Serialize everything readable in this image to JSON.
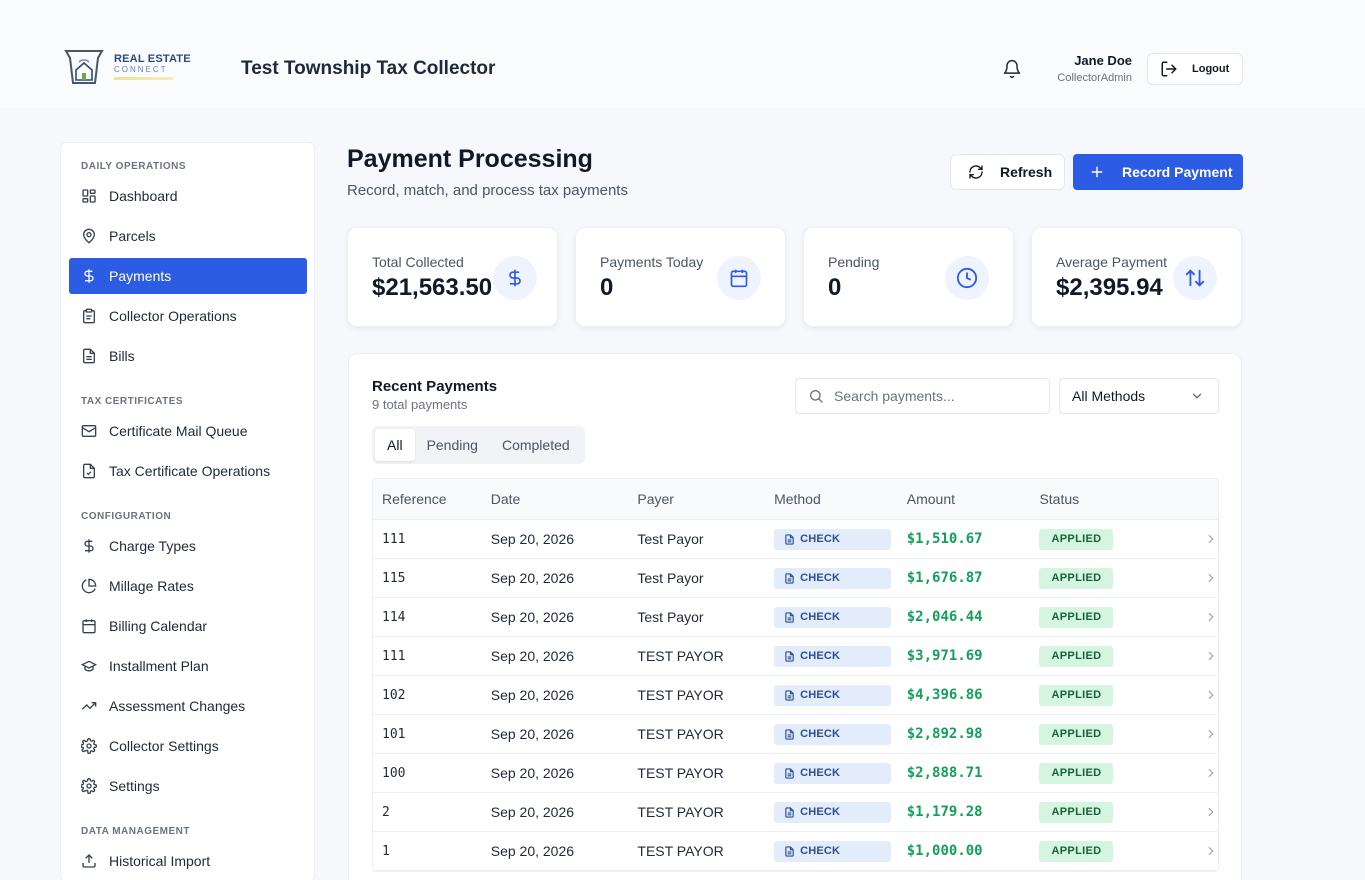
{
  "brand": {
    "logo_line1": "REAL ESTATE",
    "logo_line2": "CONNECT",
    "app_title": "Test Township Tax Collector"
  },
  "user": {
    "name": "Jane Doe",
    "role": "CollectorAdmin",
    "logout_label": "Logout"
  },
  "sidebar": {
    "sections": [
      "DAILY OPERATIONS",
      "TAX CERTIFICATES",
      "CONFIGURATION",
      "DATA MANAGEMENT"
    ],
    "items": [
      {
        "label": "Dashboard",
        "icon": "dashboard-icon"
      },
      {
        "label": "Parcels",
        "icon": "map-pin-icon"
      },
      {
        "label": "Payments",
        "icon": "dollar-icon",
        "active": true
      },
      {
        "label": "Collector Operations",
        "icon": "clipboard-icon"
      },
      {
        "label": "Bills",
        "icon": "file-icon"
      },
      {
        "label": "Certificate Mail Queue",
        "icon": "mail-icon"
      },
      {
        "label": "Tax Certificate Operations",
        "icon": "file-check-icon"
      },
      {
        "label": "Charge Types",
        "icon": "dollar-icon"
      },
      {
        "label": "Millage Rates",
        "icon": "pie-chart-icon"
      },
      {
        "label": "Billing Calendar",
        "icon": "calendar-icon"
      },
      {
        "label": "Installment Plan",
        "icon": "graduation-cap-icon"
      },
      {
        "label": "Assessment Changes",
        "icon": "trending-up-icon"
      },
      {
        "label": "Collector Settings",
        "icon": "gear-icon"
      },
      {
        "label": "Settings",
        "icon": "gear-icon"
      },
      {
        "label": "Historical Import",
        "icon": "upload-icon"
      }
    ]
  },
  "page": {
    "title": "Payment Processing",
    "subtitle": "Record, match, and process tax payments",
    "refresh_label": "Refresh",
    "record_label": "Record Payment"
  },
  "stats": [
    {
      "label": "Total Collected",
      "value": "$21,563.50",
      "icon": "dollar-icon"
    },
    {
      "label": "Payments Today",
      "value": "0",
      "icon": "calendar-icon"
    },
    {
      "label": "Pending",
      "value": "0",
      "icon": "clock-icon"
    },
    {
      "label": "Average Payment",
      "value": "$2,395.94",
      "icon": "arrows-up-down-icon"
    }
  ],
  "recent": {
    "title": "Recent Payments",
    "count_text": "9 total payments",
    "search_placeholder": "Search payments...",
    "method_filter": "All Methods",
    "tabs": [
      "All",
      "Pending",
      "Completed"
    ],
    "columns": [
      "Reference",
      "Date",
      "Payer",
      "Method",
      "Amount",
      "Status"
    ],
    "rows": [
      {
        "ref": "111",
        "date": "Sep 20, 2026",
        "payer": "Test Payor",
        "method": "CHECK",
        "amount": "$1,510.67",
        "status": "APPLIED"
      },
      {
        "ref": "115",
        "date": "Sep 20, 2026",
        "payer": "Test Payor",
        "method": "CHECK",
        "amount": "$1,676.87",
        "status": "APPLIED"
      },
      {
        "ref": "114",
        "date": "Sep 20, 2026",
        "payer": "Test Payor",
        "method": "CHECK",
        "amount": "$2,046.44",
        "status": "APPLIED"
      },
      {
        "ref": "111",
        "date": "Sep 20, 2026",
        "payer": "TEST PAYOR",
        "method": "CHECK",
        "amount": "$3,971.69",
        "status": "APPLIED"
      },
      {
        "ref": "102",
        "date": "Sep 20, 2026",
        "payer": "TEST PAYOR",
        "method": "CHECK",
        "amount": "$4,396.86",
        "status": "APPLIED"
      },
      {
        "ref": "101",
        "date": "Sep 20, 2026",
        "payer": "TEST PAYOR",
        "method": "CHECK",
        "amount": "$2,892.98",
        "status": "APPLIED"
      },
      {
        "ref": "100",
        "date": "Sep 20, 2026",
        "payer": "TEST PAYOR",
        "method": "CHECK",
        "amount": "$2,888.71",
        "status": "APPLIED"
      },
      {
        "ref": "2",
        "date": "Sep 20, 2026",
        "payer": "TEST PAYOR",
        "method": "CHECK",
        "amount": "$1,179.28",
        "status": "APPLIED"
      },
      {
        "ref": "1",
        "date": "Sep 20, 2026",
        "payer": "TEST PAYOR",
        "method": "CHECK",
        "amount": "$1,000.00",
        "status": "APPLIED"
      }
    ]
  },
  "colors": {
    "accent": "#2c5ce4",
    "amount_green": "#14a05a",
    "status_bg": "#d6f5e0",
    "method_bg": "#e2ecfb"
  }
}
